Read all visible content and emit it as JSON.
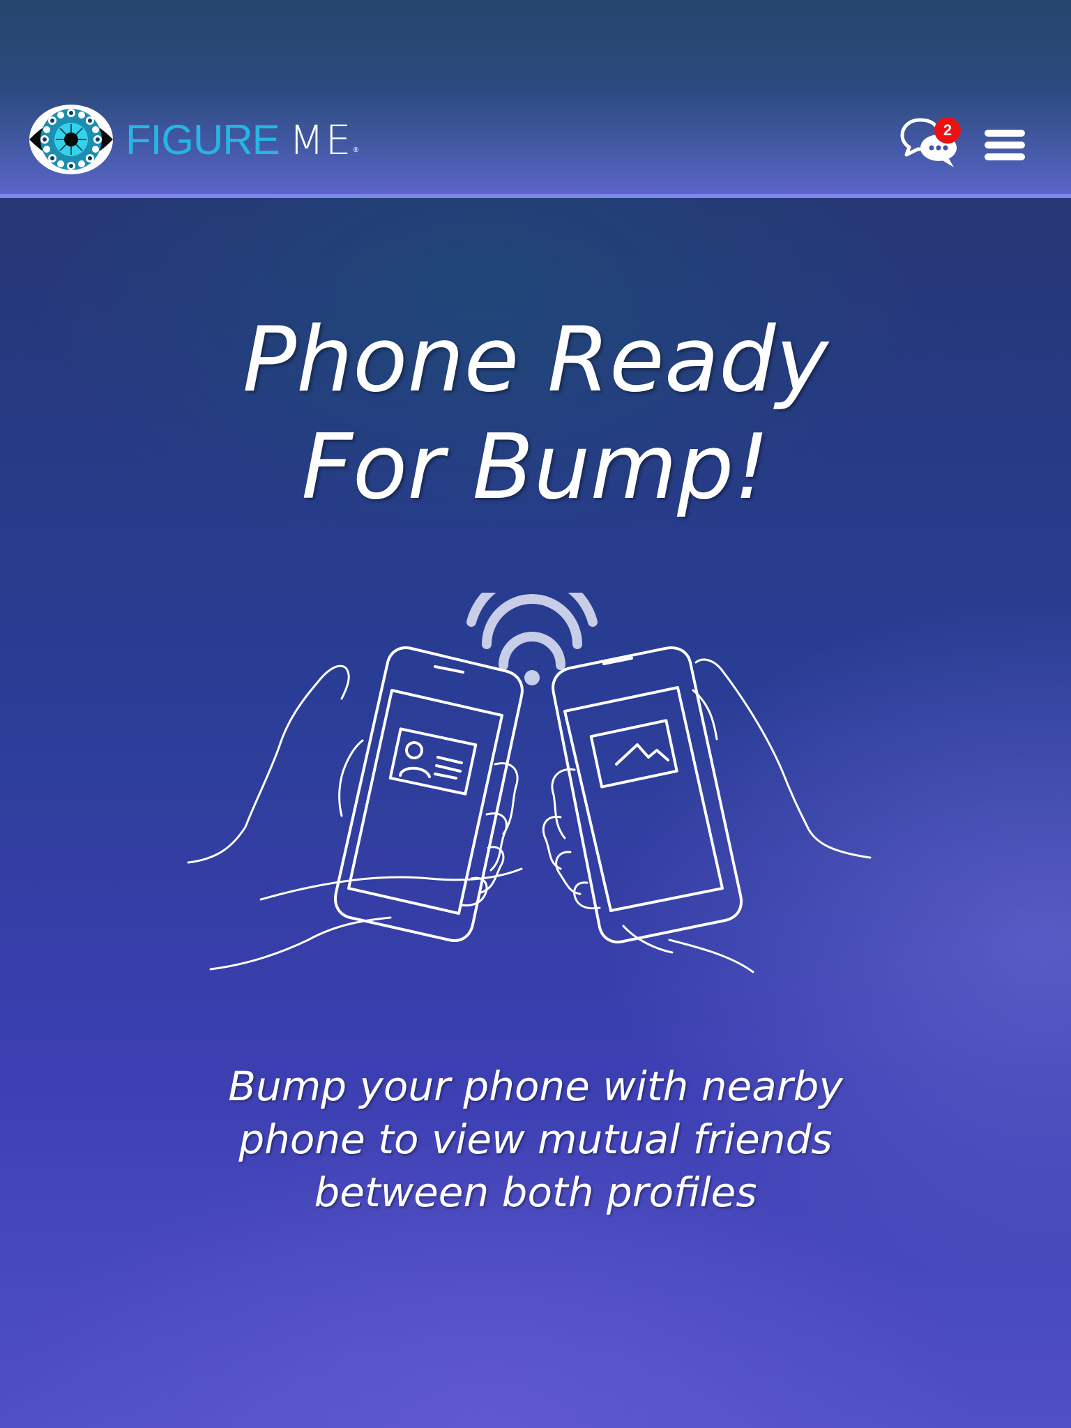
{
  "header": {
    "brand_figure": "FIGURE",
    "brand_me": "ME",
    "brand_reg": "®",
    "logo_icon": "eye-logo-icon",
    "chat_icon": "chat-bubbles-icon",
    "chat_badge_count": "2",
    "menu_icon": "hamburger-menu-icon"
  },
  "main": {
    "headline_line1": "Phone Ready",
    "headline_line2": "For Bump!",
    "illustration_icon": "hands-bumping-phones-icon",
    "description_line1": "Bump your phone with nearby",
    "description_line2": "phone to view mutual friends",
    "description_line3": "between both profiles"
  },
  "colors": {
    "brand_blue": "#27b6e4",
    "badge_red": "#ee1111",
    "header_bottom_border": "#7d87ee",
    "background_top": "#253468",
    "background_bottom": "#5050c4"
  }
}
